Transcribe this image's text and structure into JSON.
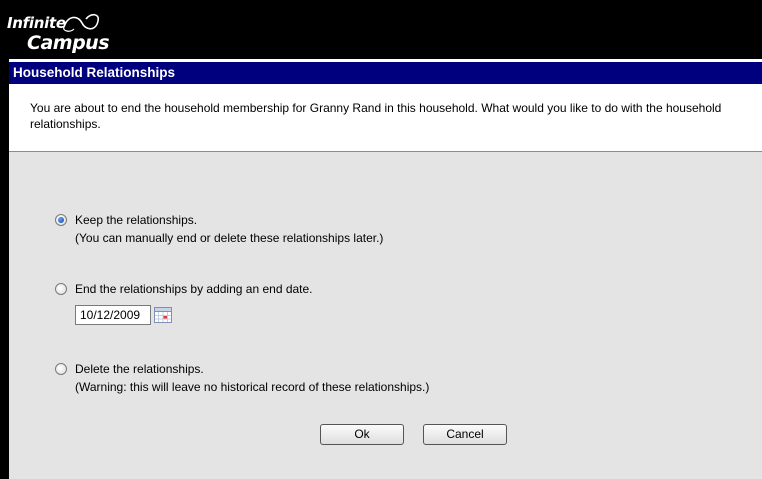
{
  "header": {
    "logo_top": "Infinite",
    "logo_bottom": "Campus"
  },
  "dialog": {
    "title": "Household Relationships",
    "message": "You are about to end the household membership for Granny Rand in this household. What would you like to do with the household relationships.",
    "options": [
      {
        "label": "Keep the relationships.",
        "sublabel": "(You can manually end or delete these relationships later.)",
        "selected": true
      },
      {
        "label": "End the relationships by adding an end date.",
        "date_value": "10/12/2009",
        "selected": false
      },
      {
        "label": "Delete the relationships.",
        "sublabel": "(Warning: this will leave no historical record of these relationships.)",
        "selected": false
      }
    ],
    "ok_label": "Ok",
    "cancel_label": "Cancel"
  },
  "colors": {
    "title_bar": "#00007f",
    "background": "#e4e4e4",
    "header": "#000000"
  }
}
